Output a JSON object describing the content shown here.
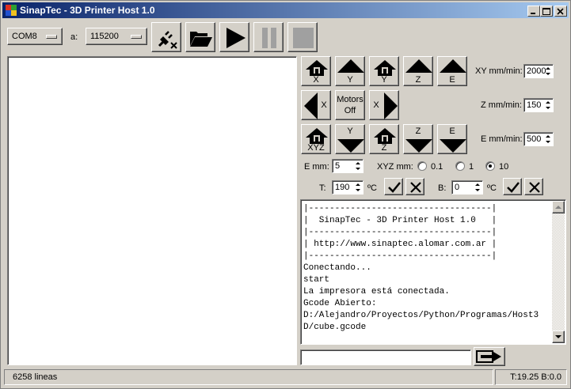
{
  "window": {
    "title": "SinapTec - 3D Printer Host 1.0"
  },
  "toolbar": {
    "port_value": "COM8",
    "baud_label": "a:",
    "baud_value": "115200"
  },
  "jog": {
    "home_x": "X",
    "up_y": "Y",
    "home_y": "Y",
    "up_z": "Z",
    "up_e": "E",
    "left_x": "X",
    "motors_off": "Motors",
    "motors_off2": "Off",
    "right_x": "X",
    "home_xyz": "XYZ",
    "down_y": "Y",
    "home_z": "Z",
    "down_z": "Z",
    "down_e": "E"
  },
  "speeds": {
    "xy_label": "XY mm/min:",
    "xy_value": "2000",
    "z_label": "Z mm/min:",
    "z_value": "150",
    "e_label": "E mm/min:",
    "e_value": "500"
  },
  "step": {
    "emm_label": "E mm:",
    "emm_value": "5",
    "xyz_label": "XYZ mm:",
    "options": [
      "0.1",
      "1",
      "10"
    ],
    "selected": "10"
  },
  "temps": {
    "t_label": "T:",
    "t_value": "190",
    "t_unit": "ºC",
    "b_label": "B:",
    "b_value": "0",
    "b_unit": "ºC"
  },
  "console": {
    "lines": [
      "|-----------------------------------|",
      "|  SinapTec - 3D Printer Host 1.0   |",
      "|-----------------------------------|",
      "| http://www.sinaptec.alomar.com.ar |",
      "|-----------------------------------|",
      "Conectando...",
      "start",
      "La impresora está conectada.",
      "Gcode Abierto:",
      "D:/Alejandro/Proyectos/Python/Programas/Host3",
      "D/cube.gcode"
    ]
  },
  "command": {
    "value": ""
  },
  "status": {
    "lines": "6258 lineas",
    "temps": "T:19.25 B:0.0"
  },
  "colors": {
    "titlebar_start": "#0a246a",
    "titlebar_end": "#a6caf0",
    "face": "#d4d0c8"
  }
}
